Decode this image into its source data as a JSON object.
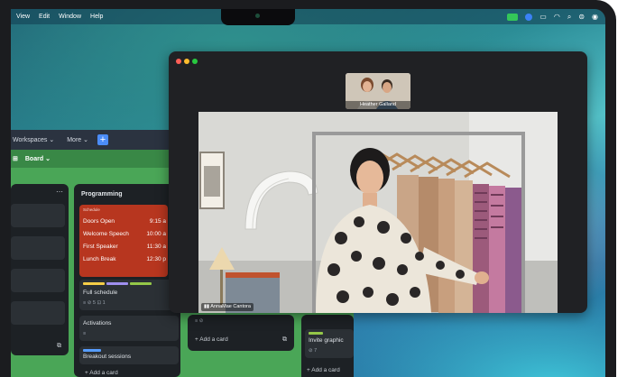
{
  "menubar": {
    "items": [
      "View",
      "Edit",
      "Window",
      "Help"
    ]
  },
  "board": {
    "nav": {
      "workspaces": "Workspaces",
      "more": "More",
      "add": "+"
    },
    "board_switch": "Board",
    "lists": {
      "programming": {
        "title": "Programming",
        "schedule_header": "Schedule",
        "schedule": [
          {
            "item": "Doors Open",
            "time": "9:15 a"
          },
          {
            "item": "Welcome Speech",
            "time": "10:00 a"
          },
          {
            "item": "First Speaker",
            "time": "11:30 a"
          },
          {
            "item": "Lunch Break",
            "time": "12:30 p"
          }
        ],
        "cards": [
          {
            "title": "Full schedule",
            "meta": "≡  ⊘ 5  ⊡ 1"
          },
          {
            "title": "Activations",
            "meta": "≡"
          },
          {
            "title": "Breakout sessions",
            "meta": ""
          }
        ],
        "add_card": "+ Add a card"
      },
      "middle": {
        "add_card": "+ Add a card"
      },
      "right": {
        "card_title": "Invite graphic",
        "card_meta": "⊘ 7",
        "add_card": "+ Add a card"
      }
    }
  },
  "facetime": {
    "thumbnail_name": "Heather Galland",
    "main_name": "AnnaMae Cantora"
  },
  "colors": {
    "board_green": "#4aa657",
    "schedule_red": "#b7361f",
    "accent_blue": "#4b8df8",
    "facetime_green": "#34c759"
  }
}
